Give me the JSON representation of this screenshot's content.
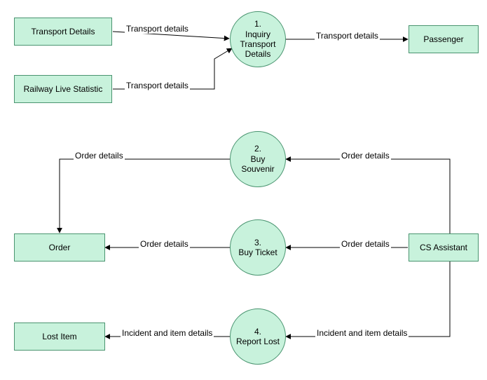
{
  "entities": {
    "transportDetails": "Transport Details",
    "railwayLiveStatistic": "Railway Live Statistic",
    "passenger": "Passenger",
    "order": "Order",
    "csAssistant": "CS Assistant",
    "lostItem": "Lost Item"
  },
  "processes": {
    "p1": {
      "num": "1.",
      "name": "Inquiry Transport Details"
    },
    "p2": {
      "num": "2.",
      "name": "Buy Souvenir"
    },
    "p3": {
      "num": "3.",
      "name": "Buy Ticket"
    },
    "p4": {
      "num": "4.",
      "name": "Report Lost"
    }
  },
  "flows": {
    "f_td_to_p1": "Transport details",
    "f_rls_to_p1": "Transport details",
    "f_p1_to_passenger": "Transport details",
    "f_cs_to_p2": "Order details",
    "f_p2_to_order": "Order details",
    "f_cs_to_p3": "Order details",
    "f_p3_to_order": "Order details",
    "f_cs_to_p4": "Incident and item details",
    "f_p4_to_lost": "Incident and item details"
  },
  "chart_data": {
    "type": "data-flow-diagram",
    "external_entities": [
      "Transport Details",
      "Railway Live Statistic",
      "Passenger",
      "Order",
      "CS Assistant",
      "Lost Item"
    ],
    "processes": [
      {
        "id": "1",
        "name": "Inquiry Transport Details"
      },
      {
        "id": "2",
        "name": "Buy Souvenir"
      },
      {
        "id": "3",
        "name": "Buy Ticket"
      },
      {
        "id": "4",
        "name": "Report Lost"
      }
    ],
    "flows": [
      {
        "from": "Transport Details",
        "to": "1",
        "label": "Transport details"
      },
      {
        "from": "Railway Live Statistic",
        "to": "1",
        "label": "Transport details"
      },
      {
        "from": "1",
        "to": "Passenger",
        "label": "Transport details"
      },
      {
        "from": "CS Assistant",
        "to": "2",
        "label": "Order details"
      },
      {
        "from": "2",
        "to": "Order",
        "label": "Order details"
      },
      {
        "from": "CS Assistant",
        "to": "3",
        "label": "Order details"
      },
      {
        "from": "3",
        "to": "Order",
        "label": "Order details"
      },
      {
        "from": "CS Assistant",
        "to": "4",
        "label": "Incident and item details"
      },
      {
        "from": "4",
        "to": "Lost Item",
        "label": "Incident and item details"
      }
    ]
  }
}
